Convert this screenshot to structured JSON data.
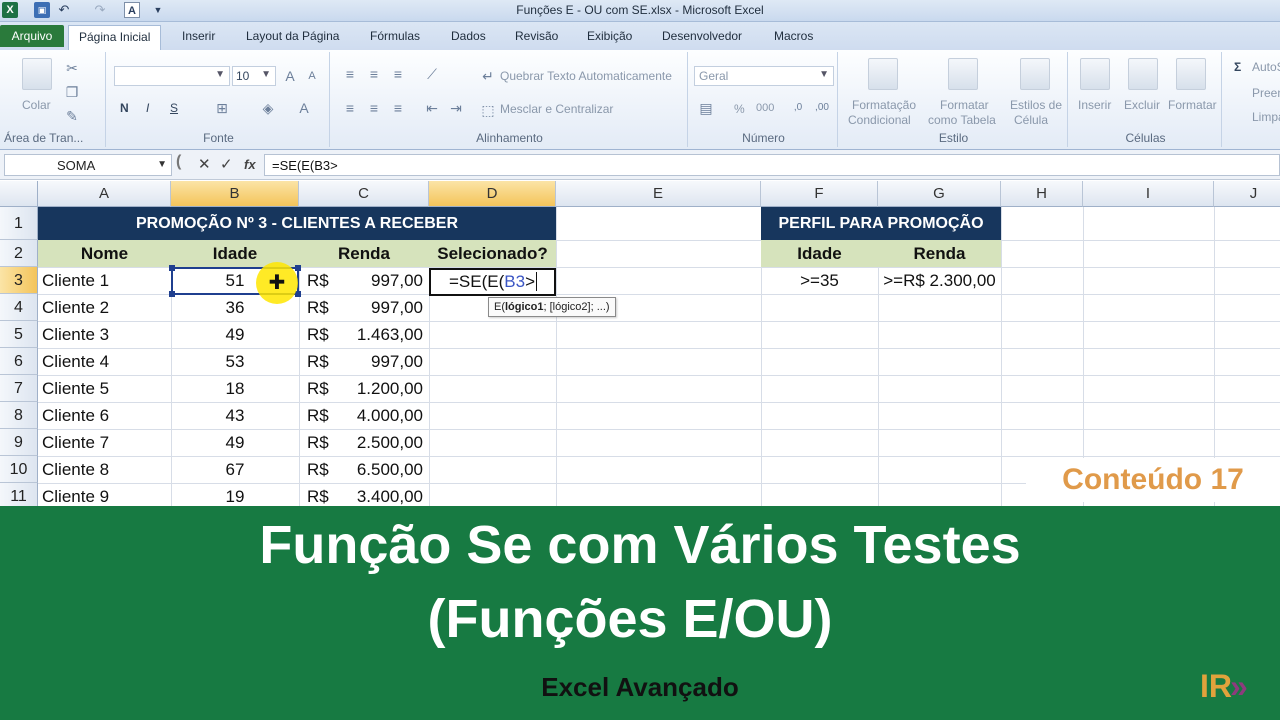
{
  "window": {
    "title": "Funções E - OU com SE.xlsx - Microsoft Excel"
  },
  "tabs": [
    "Arquivo",
    "Página Inicial",
    "Inserir",
    "Layout da Página",
    "Fórmulas",
    "Dados",
    "Revisão",
    "Exibição",
    "Desenvolvedor",
    "Macros"
  ],
  "ribbon": {
    "clipboard": {
      "colar": "Colar",
      "label": "Área de Tran..."
    },
    "font": {
      "size": "10",
      "bold": "N",
      "italic": "I",
      "underline": "S",
      "label": "Fonte"
    },
    "alignment": {
      "wrap": "Quebrar Texto Automaticamente",
      "merge": "Mesclar e Centralizar",
      "label": "Alinhamento"
    },
    "number": {
      "format": "Geral",
      "percent": "%",
      "thousands": "000",
      "label": "Número"
    },
    "styles": {
      "cond1": "Formatação",
      "cond2": "Condicional",
      "table1": "Formatar",
      "table2": "como Tabela",
      "cell1": "Estilos de",
      "cell2": "Célula",
      "label": "Estilo"
    },
    "cells": {
      "insert": "Inserir",
      "delete": "Excluir",
      "format": "Formatar",
      "label": "Células"
    },
    "editing": {
      "sum": "AutoS",
      "fill": "Preen",
      "clear": "Limpa"
    }
  },
  "formula_bar": {
    "name_box": "SOMA",
    "fx": "fx",
    "formula": "=SE(E(B3>"
  },
  "grid": {
    "columns": [
      "A",
      "B",
      "C",
      "D",
      "E",
      "F",
      "G",
      "H",
      "I",
      "J"
    ],
    "rows": [
      "1",
      "2",
      "3",
      "4",
      "5",
      "6",
      "7",
      "8",
      "9",
      "10",
      "11"
    ],
    "banner": "PROMOÇÃO Nº 3 - CLIENTES A RECEBER",
    "headers": {
      "nome": "Nome",
      "idade": "Idade",
      "renda": "Renda",
      "selecionado": "Selecionado?"
    },
    "currency": "R$",
    "data": [
      {
        "nome": "Cliente 1",
        "idade": "51",
        "renda": "997,00"
      },
      {
        "nome": "Cliente 2",
        "idade": "36",
        "renda": "997,00"
      },
      {
        "nome": "Cliente 3",
        "idade": "49",
        "renda": "1.463,00"
      },
      {
        "nome": "Cliente 4",
        "idade": "53",
        "renda": "997,00"
      },
      {
        "nome": "Cliente 5",
        "idade": "18",
        "renda": "1.200,00"
      },
      {
        "nome": "Cliente 6",
        "idade": "43",
        "renda": "4.000,00"
      },
      {
        "nome": "Cliente 7",
        "idade": "49",
        "renda": "2.500,00"
      },
      {
        "nome": "Cliente 8",
        "idade": "67",
        "renda": "6.500,00"
      },
      {
        "nome": "Cliente 9",
        "idade": "19",
        "renda": "3.400,00"
      }
    ],
    "edit_cell": {
      "prefix": "=SE(E(",
      "ref": "B3",
      "suffix": ">"
    },
    "tooltip": {
      "fn": "E(",
      "arg1": "lógico1",
      "rest": "; [lógico2]; ...)"
    },
    "profile": {
      "title": "PERFIL PARA PROMOÇÃO",
      "h_idade": "Idade",
      "h_renda": "Renda",
      "v_idade": ">=35",
      "v_renda": ">=R$ 2.300,00"
    }
  },
  "overlay": {
    "badge": "Conteúdo 17",
    "title_line1": "Função Se com Vários Testes",
    "title_line2": "(Funções E/OU)",
    "subtitle": "Excel Avançado",
    "logo": "IR",
    "logo_chevron": "»"
  },
  "colors": {
    "excel_green": "#177a42",
    "banner_navy": "#17365d",
    "header_green": "#d6e3bc",
    "accent_orange": "#e09a4a"
  }
}
